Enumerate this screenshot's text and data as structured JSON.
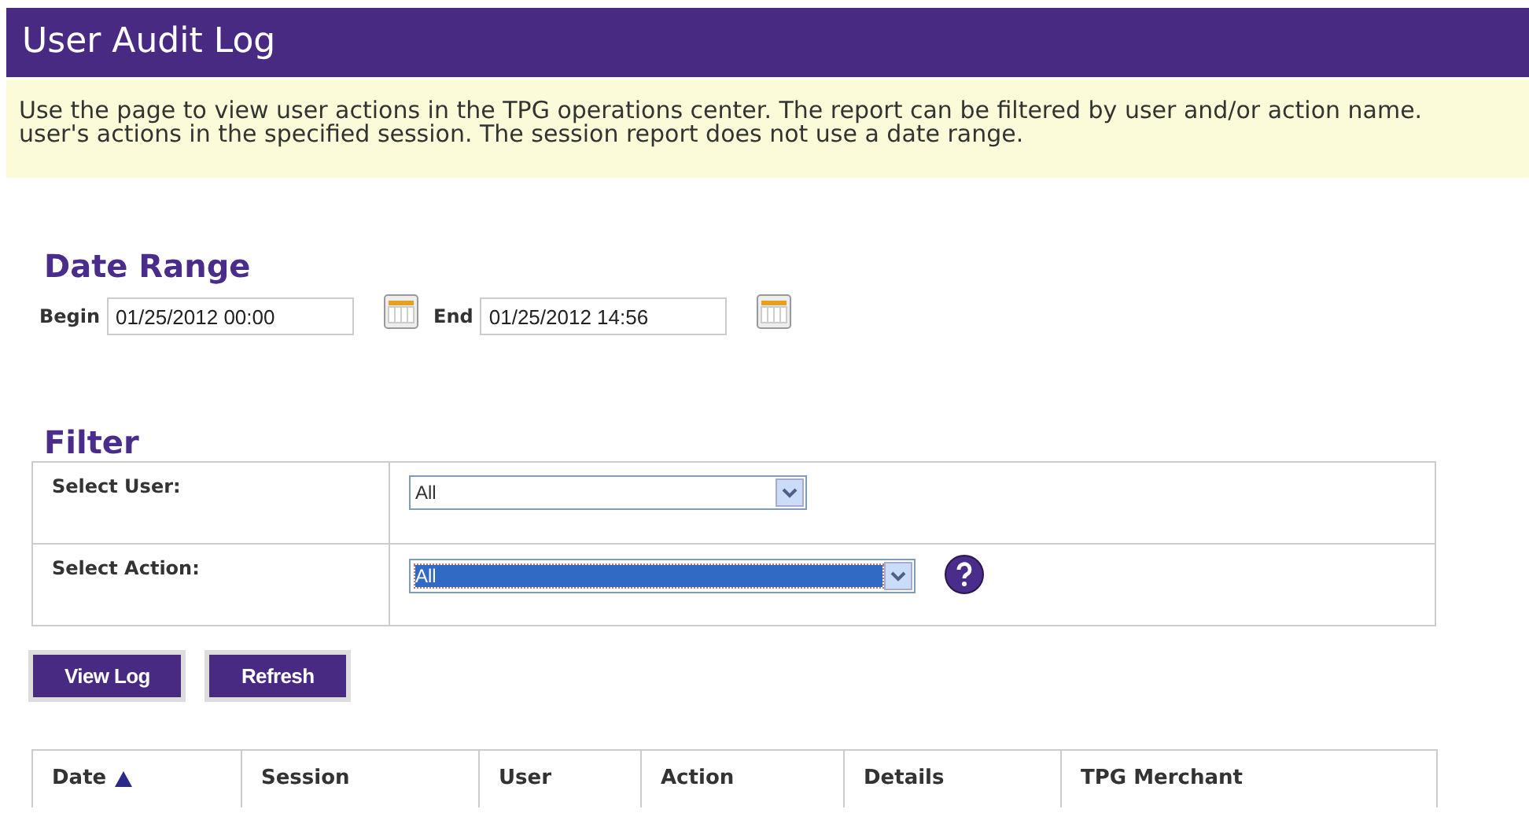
{
  "header": {
    "title": "User Audit Log"
  },
  "description": {
    "lines": [
      "Use the page to view user actions in the TPG operations center. The report can be filtered by user and/or action name.",
      "user's actions in the specified session. The session report does not use a date range."
    ]
  },
  "date_range": {
    "heading": "Date Range",
    "fields": [
      {
        "label": "Begin",
        "value": "01/25/2012 00:00"
      },
      {
        "label": "End",
        "value": "01/25/2012 14:56"
      }
    ]
  },
  "filter": {
    "heading": "Filter",
    "rows": [
      {
        "label": "Select User:",
        "value": "All",
        "focused": false,
        "help": false
      },
      {
        "label": "Select Action:",
        "value": "All",
        "focused": true,
        "help": true
      }
    ]
  },
  "buttons": [
    "View Log",
    "Refresh"
  ],
  "table": {
    "columns": [
      {
        "label": "Date",
        "sorted": true
      },
      {
        "label": "Session",
        "sorted": false
      },
      {
        "label": "User",
        "sorted": false
      },
      {
        "label": "Action",
        "sorted": false
      },
      {
        "label": "Details",
        "sorted": false
      },
      {
        "label": "TPG Merchant",
        "sorted": false
      }
    ]
  }
}
